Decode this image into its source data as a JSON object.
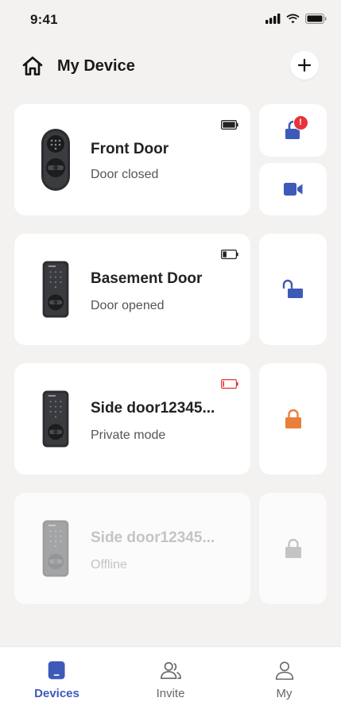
{
  "status_bar": {
    "time": "9:41"
  },
  "header": {
    "title": "My Device"
  },
  "colors": {
    "accent": "#3d5ab8",
    "private_orange": "#e8803a",
    "alert_red": "#e8323c",
    "offline_gray": "#c4c4c4"
  },
  "devices": [
    {
      "name": "Front Door",
      "status": "Door closed",
      "battery": "full",
      "lock_state": "unlocked-alert",
      "badge": "!",
      "has_camera": true
    },
    {
      "name": "Basement Door",
      "status": "Door opened",
      "battery": "low",
      "lock_state": "unlocked",
      "has_camera": false
    },
    {
      "name": "Side door12345...",
      "status": "Private mode",
      "battery": "critical",
      "lock_state": "locked-private",
      "has_camera": false
    },
    {
      "name": "Side door12345...",
      "status": "Offline",
      "battery": "none",
      "lock_state": "offline",
      "has_camera": false
    }
  ],
  "bottom_nav": [
    {
      "label": "Devices",
      "icon": "devices-icon",
      "active": true
    },
    {
      "label": "Invite",
      "icon": "people-icon",
      "active": false
    },
    {
      "label": "My",
      "icon": "person-icon",
      "active": false
    }
  ]
}
